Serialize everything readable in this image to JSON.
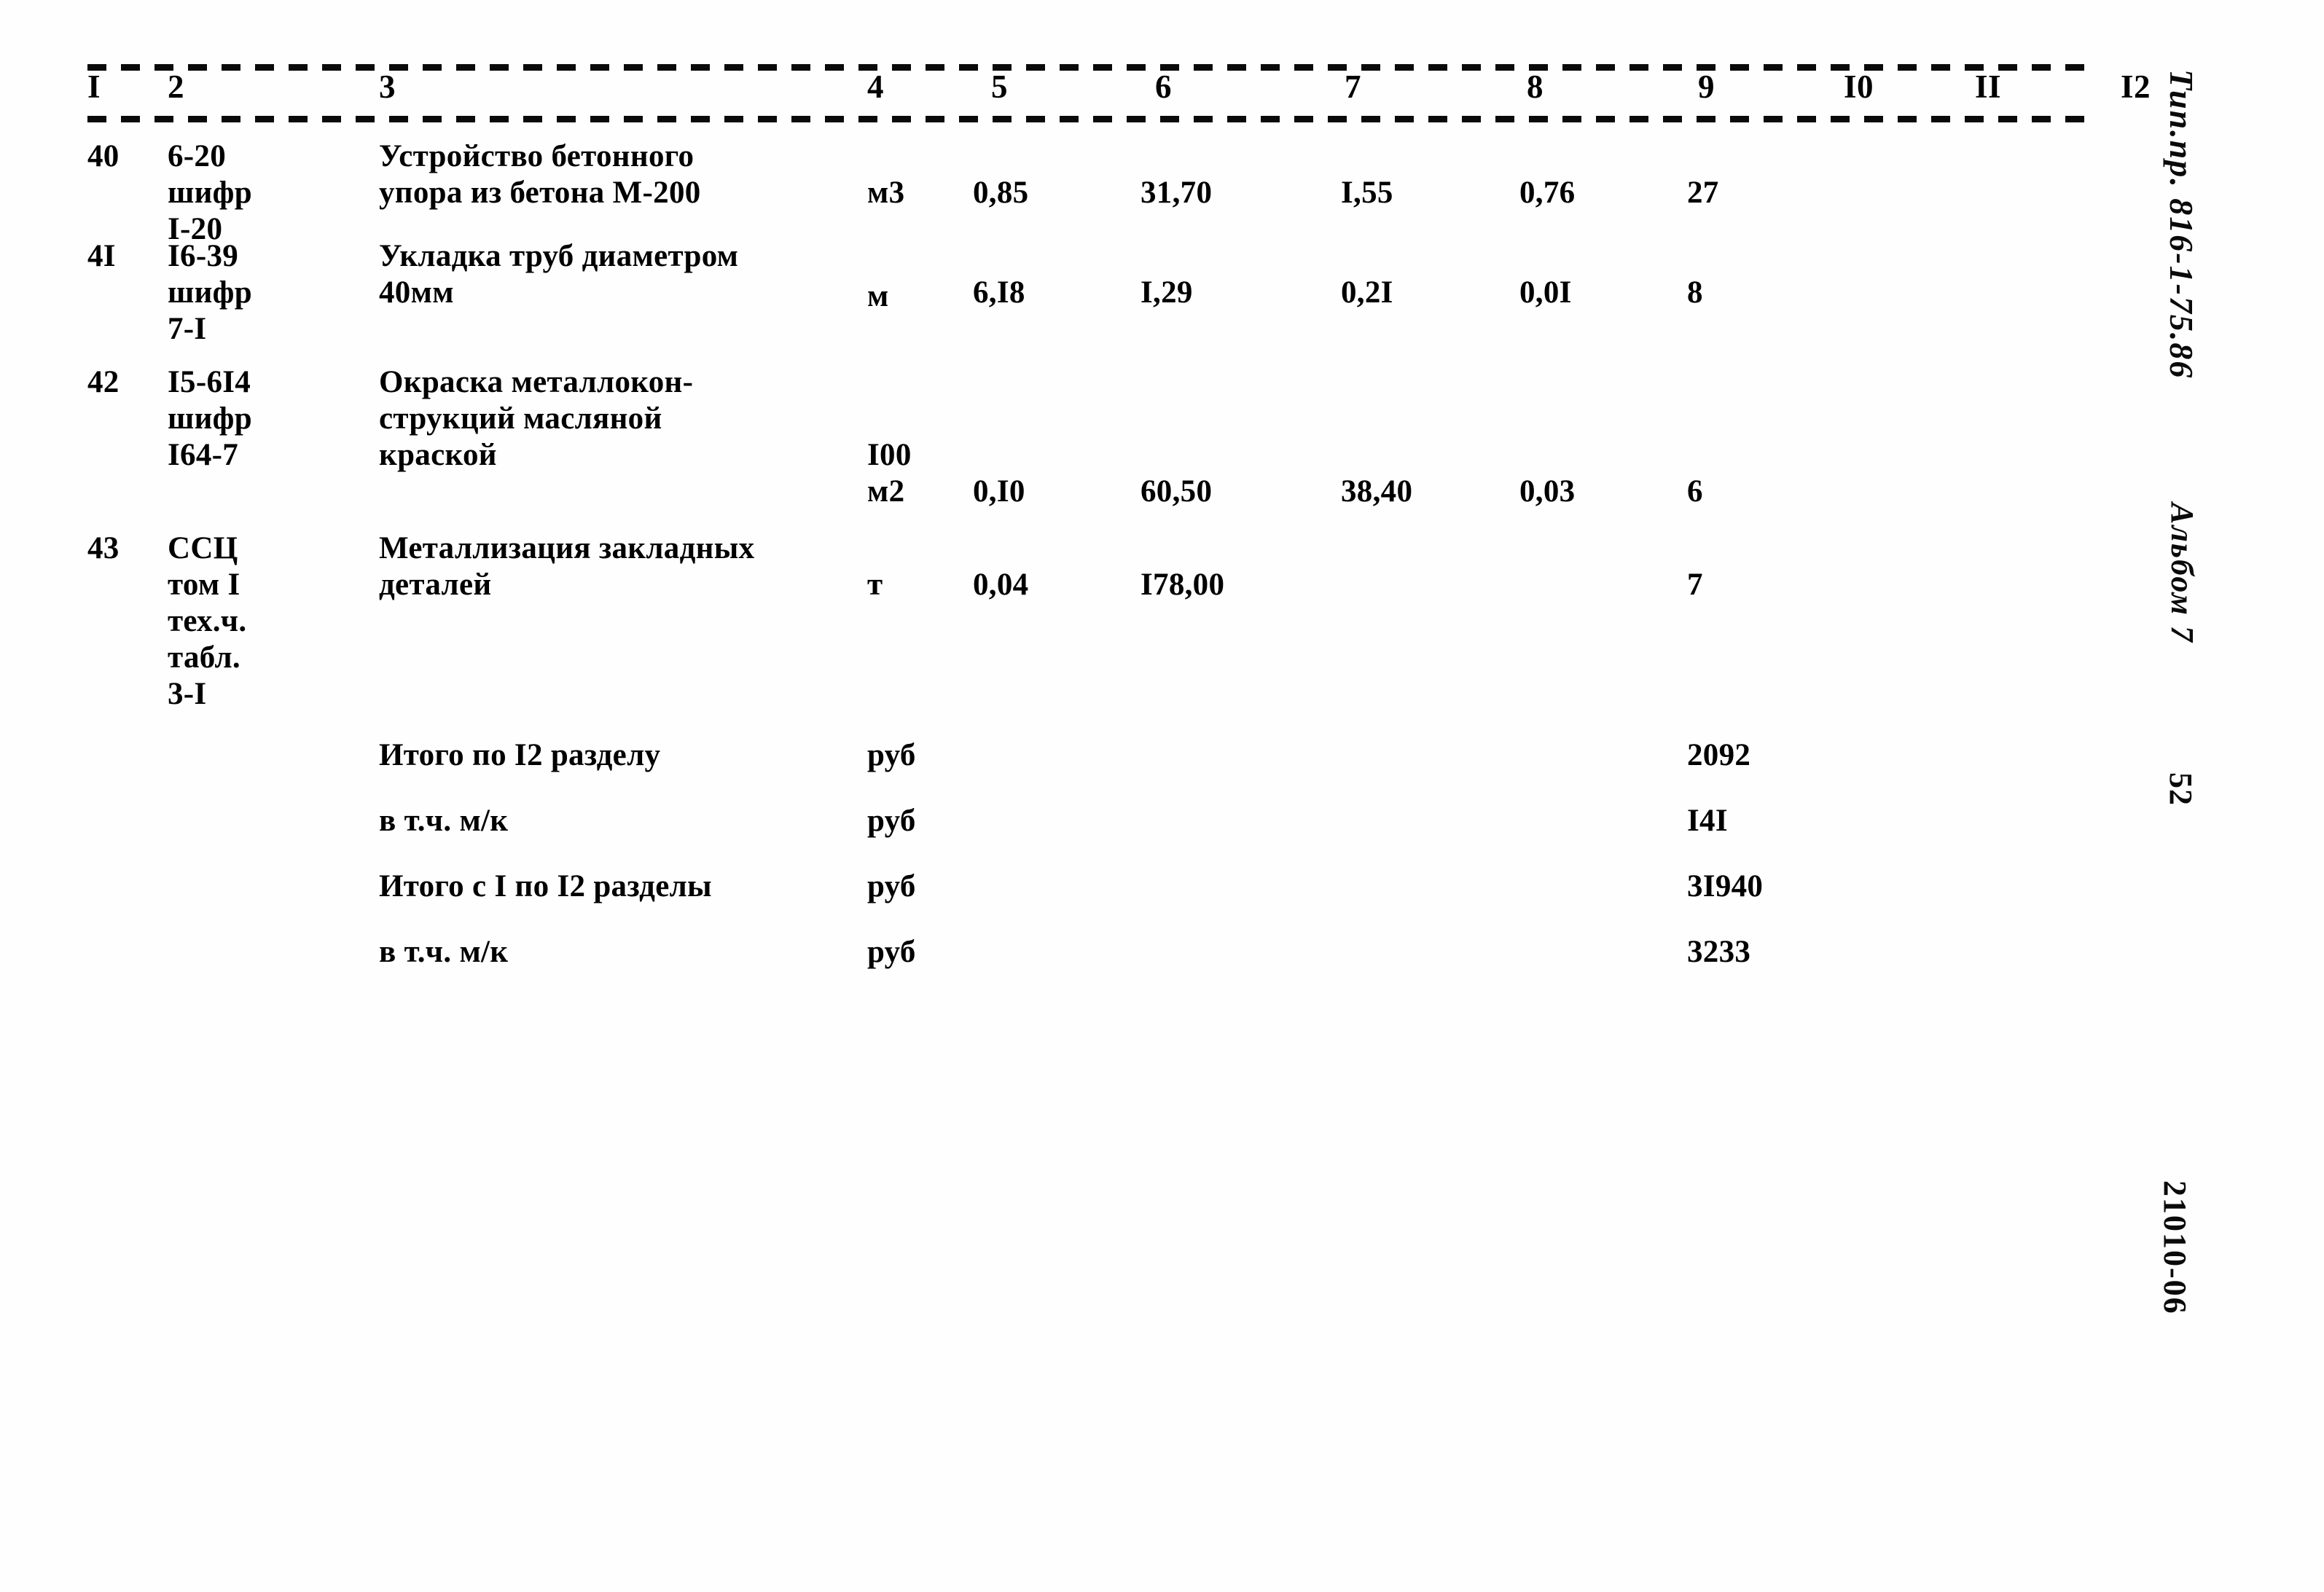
{
  "document": {
    "margin_stamps": {
      "type_project": "Тип.пр. 816-1-75.86",
      "album": "Альбом 7",
      "page_number": "52",
      "doc_number": "21010-06"
    }
  },
  "table": {
    "column_numbers": [
      "I",
      "2",
      "3",
      "4",
      "5",
      "6",
      "7",
      "8",
      "9",
      "I0",
      "II",
      "I2"
    ],
    "rows": [
      {
        "num": "40",
        "code": "6-20\nшифр\nI-20",
        "description": "Устройство бетонного\nупора из бетона М-200",
        "unit": "м3",
        "v5": "0,85",
        "v6": "31,70",
        "v7": "I,55",
        "v8": "0,76",
        "v9": "27"
      },
      {
        "num": "4I",
        "code": "I6-39\nшифр\n7-I",
        "description": "Укладка труб диаметром\n40мм",
        "unit": "м",
        "v5": "6,I8",
        "v6": "I,29",
        "v7": "0,2I",
        "v8": "0,0I",
        "v9": "8"
      },
      {
        "num": "42",
        "code": "I5-6I4\nшифр\nI64-7",
        "description": "Окраска металлокон-\nструкций масляной\nкраской",
        "unit": "I00\nм2",
        "v5": "0,I0",
        "v6": "60,50",
        "v7": "38,40",
        "v8": "0,03",
        "v9": "6"
      },
      {
        "num": "43",
        "code": "ССЦ\nтом I\nтех.ч.\nтабл.\n3-I",
        "description": "Металлизация закладных\nдеталей",
        "unit": "т",
        "v5": "0,04",
        "v6": "I78,00",
        "v7": "",
        "v8": "",
        "v9": "7"
      }
    ],
    "summary_rows": [
      {
        "label": "Итого по I2 разделу",
        "unit": "руб",
        "value": "2092"
      },
      {
        "label": "в т.ч. м/к",
        "unit": "руб",
        "value": "I4I"
      },
      {
        "label": "Итого с I по I2 разделы",
        "unit": "руб",
        "value": "3I940"
      },
      {
        "label": "в т.ч. м/к",
        "unit": "руб",
        "value": "3233"
      }
    ]
  }
}
